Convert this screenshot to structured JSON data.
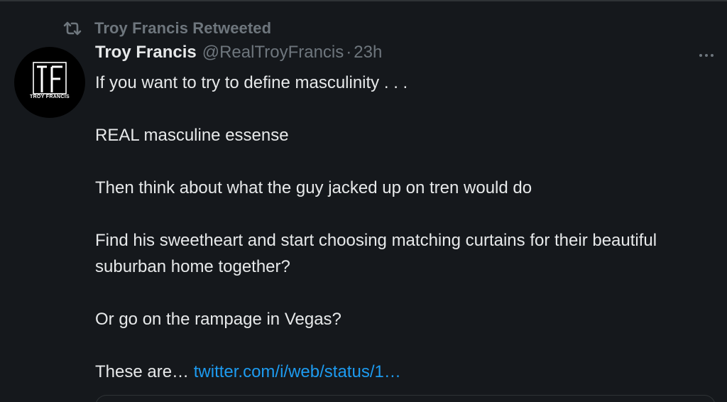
{
  "retweet_banner": {
    "icon": "retweet-icon",
    "text": "Troy Francis Retweeted"
  },
  "tweet": {
    "avatar": {
      "logo_letters": "TF",
      "caption": "TROY FRANCIS"
    },
    "author": {
      "display_name": "Troy Francis",
      "handle": "@RealTroyFrancis",
      "separator": "·",
      "time": "23h"
    },
    "more_icon": "more-horizontal-icon",
    "paragraphs": [
      "If you want to try to define masculinity . . .",
      "REAL masculine essense",
      "Then think about what the guy jacked up on tren would do",
      "Find his sweetheart and start choosing matching curtains for their beautiful suburban home together?",
      "Or go on the rampage in Vegas?"
    ],
    "truncated_prefix": "These are…",
    "link_text": "twitter.com/i/web/status/1…"
  },
  "colors": {
    "background": "#15181c",
    "primary_text": "#e7e9ea",
    "secondary_text": "#6e767d",
    "link": "#1d9bf0"
  }
}
